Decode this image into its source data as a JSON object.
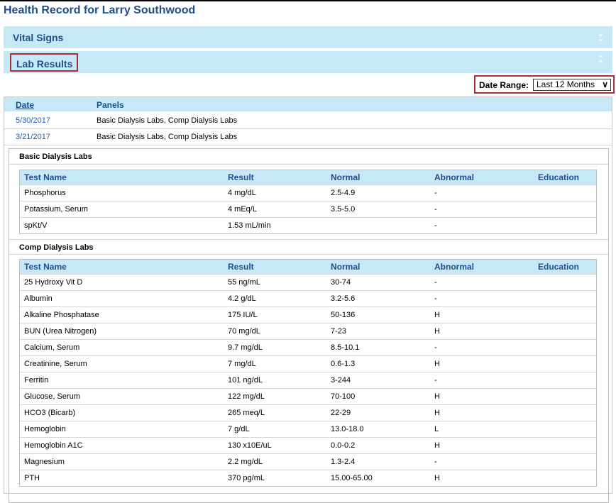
{
  "page": {
    "title": "Health Record for Larry Southwood"
  },
  "sections": {
    "vital_signs": {
      "label": "Vital Signs"
    },
    "lab_results": {
      "label": "Lab Results"
    }
  },
  "date_range": {
    "label": "Date Range:",
    "selected": "Last 12 Months"
  },
  "dates_table": {
    "headers": {
      "date": "Date",
      "panels": "Panels"
    },
    "rows": [
      {
        "date": "5/30/2017",
        "panels": "Basic Dialysis Labs, Comp Dialysis Labs"
      },
      {
        "date": "3/21/2017",
        "panels": "Basic Dialysis Labs, Comp Dialysis Labs"
      }
    ]
  },
  "lab_headers": {
    "test": "Test Name",
    "result": "Result",
    "normal": "Normal",
    "abnormal": "Abnormal",
    "education": "Education"
  },
  "basic_panel": {
    "title": "Basic Dialysis Labs",
    "rows": [
      {
        "test": "Phosphorus",
        "result": "4 mg/dL",
        "normal": "2.5-4.9",
        "abnormal": "-"
      },
      {
        "test": "Potassium, Serum",
        "result": "4 mEq/L",
        "normal": "3.5-5.0",
        "abnormal": "-"
      },
      {
        "test": "spKt/V",
        "result": "1.53 mL/min",
        "normal": "",
        "abnormal": "-"
      }
    ]
  },
  "comp_panel": {
    "title": "Comp Dialysis Labs",
    "rows": [
      {
        "test": "25 Hydroxy Vit D",
        "result": "55 ng/mL",
        "normal": "30-74",
        "abnormal": "-"
      },
      {
        "test": "Albumin",
        "result": "4.2 g/dL",
        "normal": "3.2-5.6",
        "abnormal": "-"
      },
      {
        "test": "Alkaline Phosphatase",
        "result": "175 IU/L",
        "normal": "50-136",
        "abnormal": "H"
      },
      {
        "test": "BUN (Urea Nitrogen)",
        "result": "70 mg/dL",
        "normal": "7-23",
        "abnormal": "H"
      },
      {
        "test": "Calcium, Serum",
        "result": "9.7 mg/dL",
        "normal": "8.5-10.1",
        "abnormal": "-"
      },
      {
        "test": "Creatinine, Serum",
        "result": "7 mg/dL",
        "normal": "0.6-1.3",
        "abnormal": "H"
      },
      {
        "test": "Ferritin",
        "result": "101 ng/dL",
        "normal": "3-244",
        "abnormal": "-"
      },
      {
        "test": "Glucose, Serum",
        "result": "122 mg/dL",
        "normal": "70-100",
        "abnormal": "H"
      },
      {
        "test": "HCO3 (Bicarb)",
        "result": "265 meq/L",
        "normal": "22-29",
        "abnormal": "H"
      },
      {
        "test": "Hemoglobin",
        "result": "7 g/dL",
        "normal": "13.0-18.0",
        "abnormal": "L"
      },
      {
        "test": "Hemoglobin A1C",
        "result": "130 x10E/uL",
        "normal": "0.0-0.2",
        "abnormal": "H"
      },
      {
        "test": "Magnesium",
        "result": "2.2 mg/dL",
        "normal": "1.3-2.4",
        "abnormal": "-"
      },
      {
        "test": "PTH",
        "result": "370 pg/mL",
        "normal": "15.00-65.00",
        "abnormal": "H"
      }
    ]
  },
  "icons": {
    "expand": "chevron-double-down-icon",
    "collapse": "chevron-double-up-icon",
    "dropdown": "chevron-down-icon"
  },
  "colors": {
    "header_blue": "#1f4e8c",
    "section_bg": "#c7e8f7",
    "highlight_border": "#a8313a",
    "link": "#1f5fa8"
  }
}
